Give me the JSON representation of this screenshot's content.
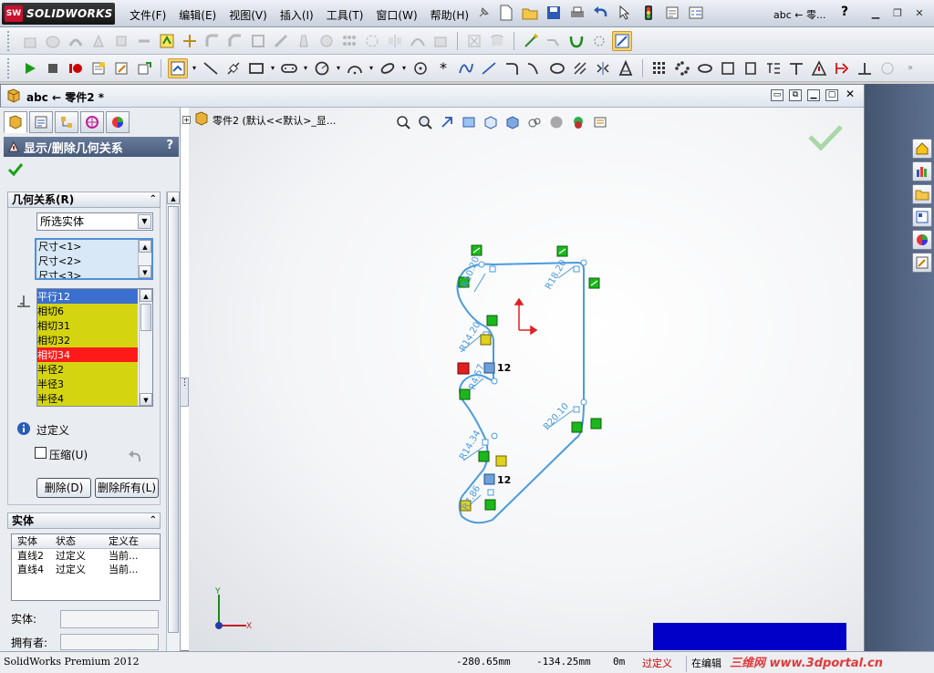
{
  "app": {
    "logo_text": "SOLIDWORKS",
    "logo_badge": "SW",
    "menus": [
      "文件(F)",
      "编辑(E)",
      "视图(V)",
      "插入(I)",
      "工具(T)",
      "窗口(W)",
      "帮助(H)"
    ],
    "breadcrumb": "abc ← 零...",
    "help": "?"
  },
  "document": {
    "title": "abc ← 零件2 *",
    "tree_label": "零件2  (默认<<默认>_显...",
    "tree_expander": "+"
  },
  "property_manager": {
    "title": "显示/删除几何关系",
    "help": "?",
    "relations_group": {
      "title": "几何关系(R)",
      "filter_selected": "所选实体",
      "entity_list": [
        "尺寸<1>",
        "尺寸<2>",
        "尺寸<3>"
      ],
      "relations": [
        {
          "label": "平行12",
          "state": "selected"
        },
        {
          "label": "相切6",
          "state": "yellow"
        },
        {
          "label": "相切31",
          "state": "yellow"
        },
        {
          "label": "相切32",
          "state": "yellow"
        },
        {
          "label": "相切34",
          "state": "red"
        },
        {
          "label": "半径2",
          "state": "yellow"
        },
        {
          "label": "半径3",
          "state": "yellow"
        },
        {
          "label": "半径4",
          "state": "yellow"
        }
      ],
      "status_text": "过定义",
      "compress_label": "压缩(U)",
      "compress_checked": false,
      "delete_button": "删除(D)",
      "delete_all_button": "删除所有(L)"
    },
    "entities_group": {
      "title": "实体",
      "columns": [
        "实体",
        "状态",
        "定义在"
      ],
      "rows": [
        [
          "直线2",
          "过定义",
          "当前..."
        ],
        [
          "直线4",
          "过定义",
          "当前..."
        ]
      ],
      "entity_label": "实体:",
      "owner_label": "拥有者:"
    }
  },
  "sketch": {
    "dimensions": [
      "R10.20",
      "R18.20",
      "R14.20",
      "R4.57",
      "R20.10",
      "R14.34",
      "R7.86"
    ],
    "relation_tag": "12",
    "axis_x": "X",
    "axis_y": "Y",
    "line_color": "#4a9be0",
    "dim_color": "#4a9be0",
    "ok_badge_color": "#1bb81b",
    "overdefined_color": "#e02020"
  },
  "status": {
    "product": "SolidWorks Premium 2012",
    "x": "-280.65mm",
    "y": "-134.25mm",
    "z": "0m",
    "state": "过定义",
    "mode": "在编辑",
    "watermark": "三维网 www.3dportal.cn"
  }
}
